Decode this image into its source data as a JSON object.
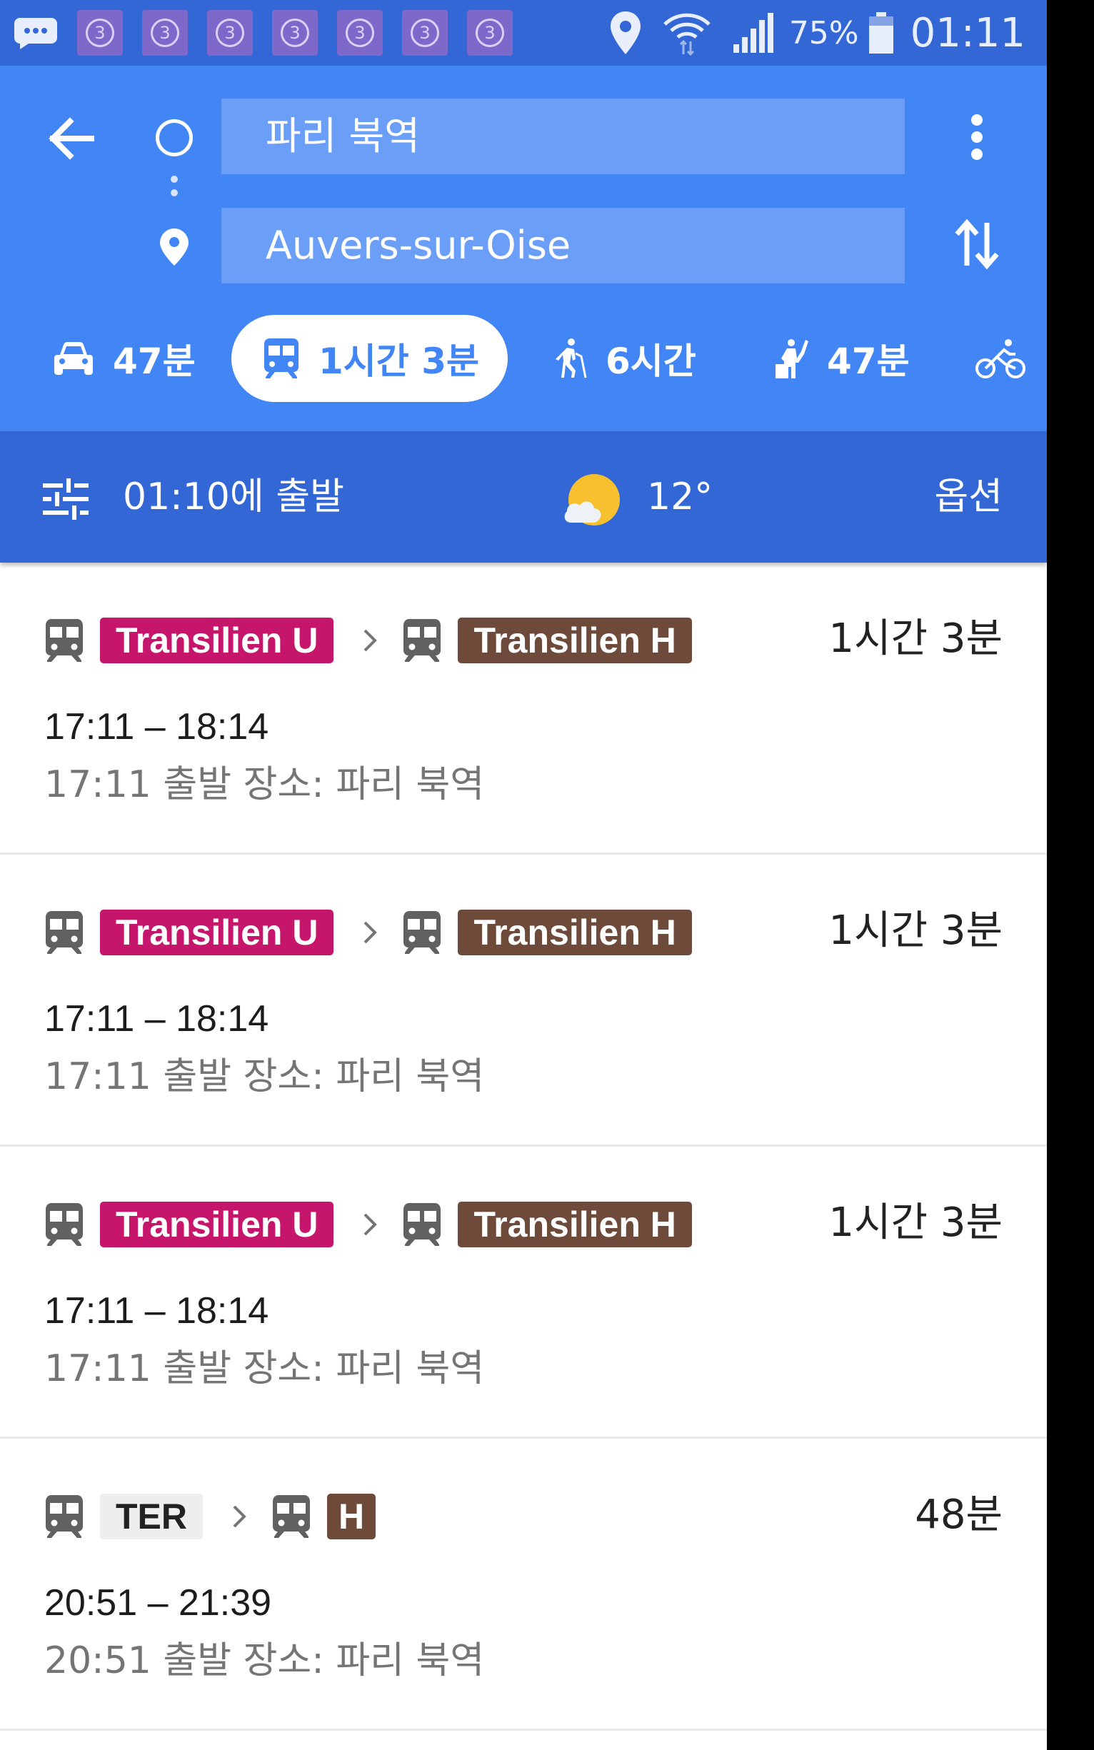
{
  "status_bar": {
    "notification_badges": [
      "3",
      "3",
      "3",
      "3",
      "3",
      "3",
      "3"
    ],
    "battery": "75%",
    "time": "01:11"
  },
  "header": {
    "origin": "파리 북역",
    "destination": "Auvers-sur-Oise"
  },
  "modes": [
    {
      "icon": "car-icon",
      "label": "47분",
      "selected": false
    },
    {
      "icon": "train-icon",
      "label": "1시간 3분",
      "selected": true
    },
    {
      "icon": "walk-icon",
      "label": "6시간",
      "selected": false
    },
    {
      "icon": "ride-hail-icon",
      "label": "47분",
      "selected": false
    },
    {
      "icon": "bike-icon",
      "label": "",
      "selected": false
    }
  ],
  "departure_bar": {
    "departure": "01:10에 출발",
    "temperature": "12°",
    "options_label": "옵션"
  },
  "colors": {
    "status_bar": "#3367d6",
    "header": "#4285f4",
    "transilien_u": "#c6166b",
    "transilien_h": "#6d4a3a",
    "ter": "#eeeeee"
  },
  "routes": [
    {
      "segments": [
        {
          "label": "Transilien U",
          "color": "#c6166b",
          "text_color": "#ffffff"
        },
        {
          "label": "Transilien H",
          "color": "#6d4a3a",
          "text_color": "#ffffff"
        }
      ],
      "duration": "1시간 3분",
      "times": "17:11 – 18:14",
      "departure_info": "17:11 출발 장소: 파리 북역"
    },
    {
      "segments": [
        {
          "label": "Transilien U",
          "color": "#c6166b",
          "text_color": "#ffffff"
        },
        {
          "label": "Transilien H",
          "color": "#6d4a3a",
          "text_color": "#ffffff"
        }
      ],
      "duration": "1시간 3분",
      "times": "17:11 – 18:14",
      "departure_info": "17:11 출발 장소: 파리 북역"
    },
    {
      "segments": [
        {
          "label": "Transilien U",
          "color": "#c6166b",
          "text_color": "#ffffff"
        },
        {
          "label": "Transilien H",
          "color": "#6d4a3a",
          "text_color": "#ffffff"
        }
      ],
      "duration": "1시간 3분",
      "times": "17:11 – 18:14",
      "departure_info": "17:11 출발 장소: 파리 북역"
    },
    {
      "segments": [
        {
          "label": "TER",
          "color": "#eeeeee",
          "text_color": "#222222"
        },
        {
          "label": "H",
          "color": "#6d4a3a",
          "text_color": "#ffffff"
        }
      ],
      "duration": "48분",
      "times": "20:51 – 21:39",
      "departure_info": "20:51 출발 장소: 파리 북역"
    }
  ]
}
